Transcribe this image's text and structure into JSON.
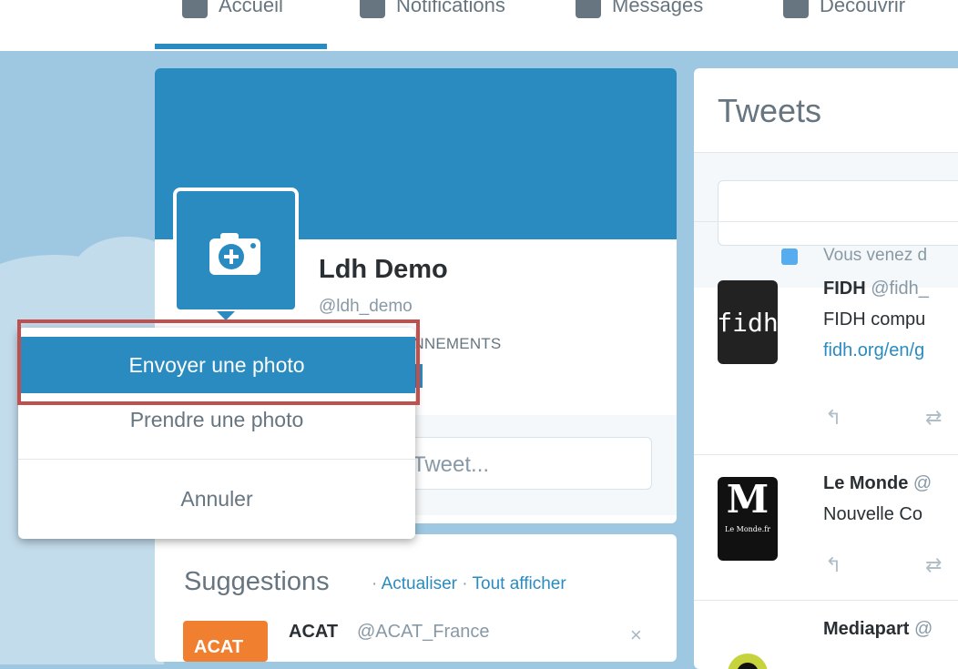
{
  "nav": {
    "items": [
      {
        "label": "Accueil"
      },
      {
        "label": "Notifications"
      },
      {
        "label": "Messages"
      },
      {
        "label": "Découvrir"
      }
    ]
  },
  "profile": {
    "name": "Ldh Demo",
    "handle": "@ldh_demo",
    "stat_label_partial": "ONNEMENTS"
  },
  "compose": {
    "placeholder_partial": "Tweet..."
  },
  "suggestions": {
    "title": "Suggestions",
    "refresh": "Actualiser",
    "view_all": "Tout afficher",
    "separator": "·",
    "items": [
      {
        "logo_text": "ACAT",
        "name": "ACAT",
        "handle": "@ACAT_France",
        "dismiss": "×"
      }
    ]
  },
  "tweets": {
    "title": "Tweets",
    "items": [
      {
        "context": "Vous venez d",
        "avatar_text": "fidh",
        "name": "FIDH",
        "handle": "@fidh_",
        "text": "FIDH compu",
        "link": "fidh.org/en/g"
      },
      {
        "avatar_text": "M",
        "avatar_sub": "Le Monde.fr",
        "name": "Le Monde",
        "handle": "@",
        "text": "Nouvelle Co"
      },
      {
        "name": "Mediapart",
        "handle": "@"
      }
    ]
  },
  "photo_menu": {
    "items": [
      {
        "label": "Envoyer une photo",
        "selected": true
      },
      {
        "label": "Prendre une photo",
        "selected": false
      },
      {
        "label": "Annuler",
        "selected": false
      }
    ]
  },
  "colors": {
    "brand_blue": "#2a8bc1",
    "background_sky": "#9ec8e2",
    "highlight_border": "#c0504d",
    "acat_orange": "#f0802f"
  }
}
